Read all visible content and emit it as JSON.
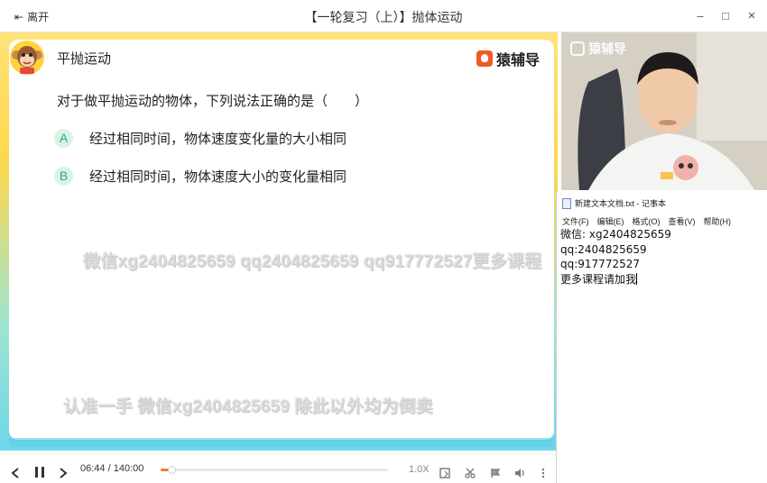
{
  "titlebar": {
    "leave_label": "离开",
    "title": "【一轮复习（上）】抛体运动",
    "minimize_glyph": "–",
    "maximize_glyph": "□",
    "close_glyph": "×"
  },
  "slide": {
    "heading": "平抛运动",
    "brand": "猿辅导",
    "question": "对于做平抛运动的物体，下列说法正确的是（　　）",
    "options": [
      {
        "letter": "A",
        "text": "经过相同时间，物体速度变化量的大小相同"
      },
      {
        "letter": "B",
        "text": "经过相同时间，物体速度大小的变化量相同"
      }
    ],
    "watermarks": [
      "微信xg2404825659 qq2404825659 qq917772527更多课程",
      "认准一手  微信xg2404825659 除此以外均为倒卖"
    ]
  },
  "player": {
    "current_time": "06:44",
    "separator": "/",
    "total_time": "140:00",
    "progress_fraction": 0.048,
    "speed": "1.0X",
    "accent": "#f47a2a"
  },
  "camera": {
    "logo": "猿辅导"
  },
  "notepad": {
    "title": "新建文本文档.txt - 记事本",
    "menu": [
      "文件(F)",
      "编辑(E)",
      "格式(O)",
      "查看(V)",
      "帮助(H)"
    ],
    "lines": [
      "微信: xg2404825659",
      "qq:2404825659",
      "qq:917772527",
      "更多课程请加我"
    ]
  }
}
